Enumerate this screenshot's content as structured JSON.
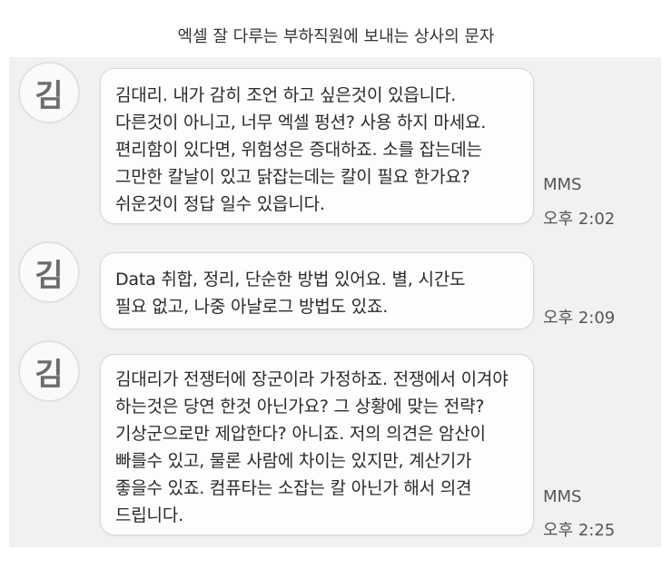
{
  "caption": "엑셀 잘 다루는 부하직원에 보내는 상사의 문자",
  "messages": [
    {
      "avatar": "김",
      "lines": [
        "김대리. 내가 감히 조언 하고 싶은것이 있읍니다.",
        "다른것이 아니고, 너무 엑셀 펑션? 사용 하지 마세요.",
        "편리함이 있다면, 위험성은 증대하죠. 소를 잡는데는",
        "그만한 칼날이 있고 닭잡는데는 칼이 필요 한가요?",
        "쉬운것이  정답 일수 있읍니다."
      ],
      "type": "MMS",
      "time": "오후 2:02"
    },
    {
      "avatar": "김",
      "lines": [
        "Data  취합, 정리, 단순한 방법 있어요.  별, 시간도",
        "필요 없고, 나중 아날로그 방법도 있죠."
      ],
      "time": "오후 2:09"
    },
    {
      "avatar": "김",
      "lines": [
        "김대리가 전쟁터에 장군이라 가정하죠. 전쟁에서 이겨야",
        "하는것은 당연 한것 아닌가요? 그 상황에 맞는 전략?",
        "기상군으로만 제압한다? 아니죠. 저의 의견은 암산이",
        "빠를수 있고, 물론 사람에 차이는 있지만, 계산기가",
        "좋을수 있죠. 컴퓨타는 소잡는 칼 아닌가 해서 의견",
        "드립니다."
      ],
      "type": "MMS",
      "time": "오후 2:25"
    }
  ]
}
